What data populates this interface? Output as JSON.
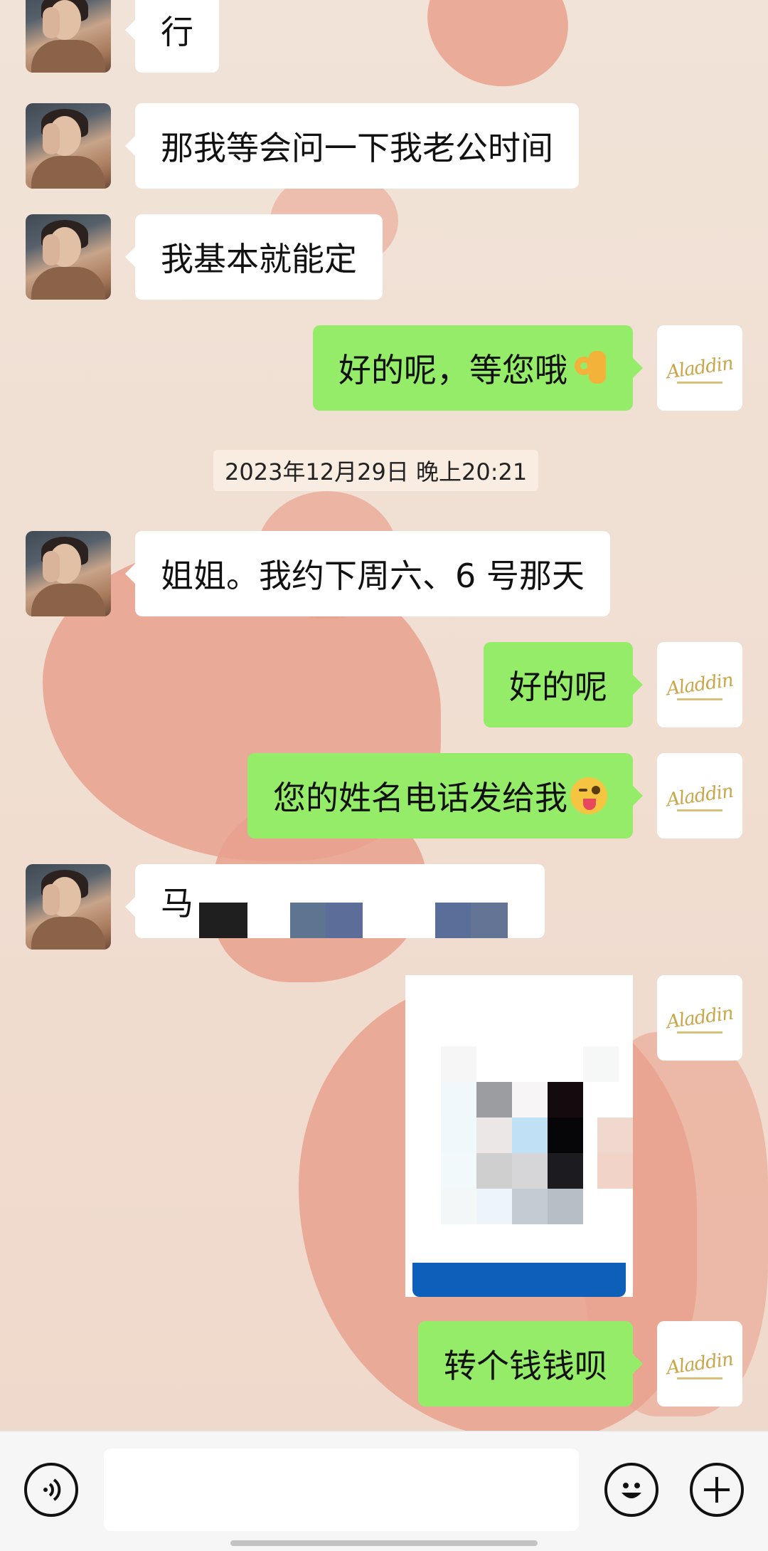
{
  "chat": {
    "timestamp": "2023年12月29日 晚上20:21",
    "messages": [
      {
        "sender": "friend",
        "text": "行"
      },
      {
        "sender": "friend",
        "text": "那我等会问一下我老公时间"
      },
      {
        "sender": "friend",
        "text": "我基本就能定"
      },
      {
        "sender": "self",
        "text": "好的呢，等您哦",
        "emoji": "ok-hand-emoji"
      },
      {
        "sender": "friend",
        "text": "姐姐。我约下周六、6 号那天"
      },
      {
        "sender": "self",
        "text": "好的呢"
      },
      {
        "sender": "self",
        "text": "您的姓名电话发给我",
        "emoji": "winking-tongue-emoji"
      },
      {
        "sender": "friend",
        "text": "马",
        "redacted": true
      },
      {
        "sender": "self",
        "type": "image",
        "pixelated": true
      },
      {
        "sender": "self",
        "text": "转个钱钱呗"
      }
    ]
  },
  "self_avatar": {
    "logo_text": "Aladdin"
  },
  "input_bar": {
    "voice_icon": "voice-icon",
    "emoji_icon": "emoji-icon",
    "plus_icon": "plus-icon",
    "input_value": ""
  },
  "colors": {
    "bubble_self": "#95ec69",
    "bubble_friend": "#ffffff",
    "background": "#efe1d6",
    "input_bar": "#f6f6f6"
  }
}
